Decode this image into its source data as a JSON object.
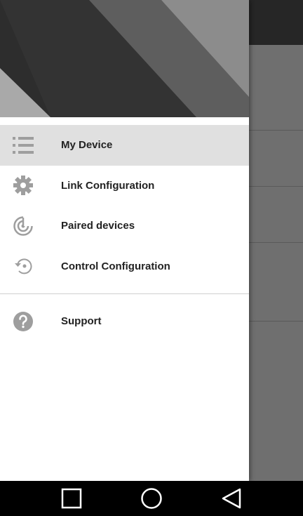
{
  "drawer": {
    "items": [
      {
        "label": "My Device",
        "icon": "list-icon",
        "selected": true
      },
      {
        "label": "Link Configuration",
        "icon": "gear-icon",
        "selected": false
      },
      {
        "label": "Paired devices",
        "icon": "radar-icon",
        "selected": false
      },
      {
        "label": "Control Configuration",
        "icon": "restore-icon",
        "selected": false
      }
    ],
    "secondary_items": [
      {
        "label": "Support",
        "icon": "help-icon",
        "selected": false
      }
    ]
  },
  "nav_bar": {
    "buttons": [
      {
        "icon": "recent-apps-icon"
      },
      {
        "icon": "home-icon"
      },
      {
        "icon": "back-icon"
      }
    ]
  },
  "colors": {
    "selected_bg": "#e0e0e0",
    "icon_gray": "#9e9e9e",
    "text": "#222222"
  }
}
